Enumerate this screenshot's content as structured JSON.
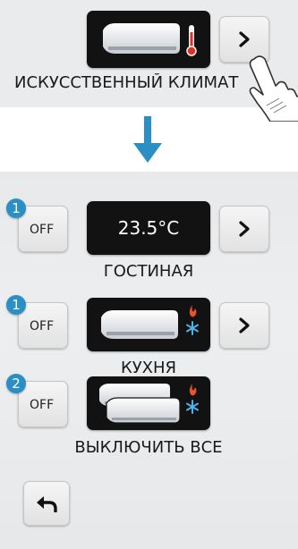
{
  "top": {
    "label": "ИСКУССТВЕННЫЙ КЛИМАТ",
    "ac_button_icon": "air-conditioner-thermometer-icon",
    "arrow_icon": "chevron-right-icon",
    "cursor_icon": "hand-pointer-icon"
  },
  "transition": {
    "arrow_icon": "arrow-down-icon",
    "arrow_color": "#2a8fc4"
  },
  "zones": [
    {
      "badge": "1",
      "off_label": "OFF",
      "display": "23.5°C",
      "label": "ГОСТИНАЯ"
    },
    {
      "badge": "1",
      "off_label": "OFF",
      "display_icon": "air-conditioner-heat-cool-icon",
      "label": "КУХНЯ"
    },
    {
      "badge": "2",
      "off_label": "OFF",
      "display_icon": "multiple-air-conditioners-heat-cool-icon",
      "label": "ВЫКЛЮЧИТЬ ВСЕ"
    }
  ],
  "back_icon": "back-arrow-icon",
  "colors": {
    "accent": "#2a8fc4",
    "flame": "#e8542a",
    "snow": "#4fb3e8"
  }
}
